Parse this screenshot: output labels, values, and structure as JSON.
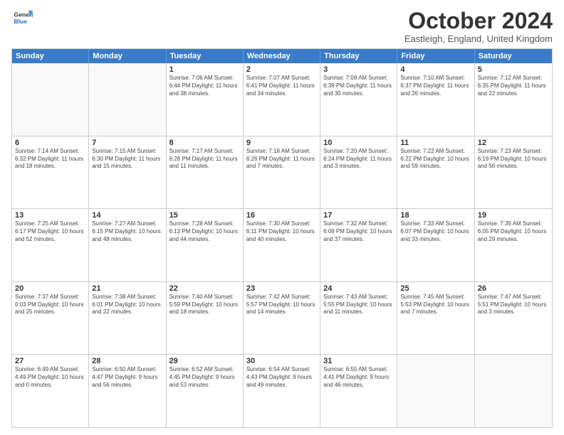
{
  "logo": {
    "general": "General",
    "blue": "Blue"
  },
  "header": {
    "month": "October 2024",
    "location": "Eastleigh, England, United Kingdom"
  },
  "weekdays": [
    "Sunday",
    "Monday",
    "Tuesday",
    "Wednesday",
    "Thursday",
    "Friday",
    "Saturday"
  ],
  "weeks": [
    [
      {
        "day": "",
        "info": ""
      },
      {
        "day": "",
        "info": ""
      },
      {
        "day": "1",
        "info": "Sunrise: 7:06 AM\nSunset: 6:44 PM\nDaylight: 11 hours and 38 minutes."
      },
      {
        "day": "2",
        "info": "Sunrise: 7:07 AM\nSunset: 6:41 PM\nDaylight: 11 hours and 34 minutes."
      },
      {
        "day": "3",
        "info": "Sunrise: 7:09 AM\nSunset: 6:39 PM\nDaylight: 11 hours and 30 minutes."
      },
      {
        "day": "4",
        "info": "Sunrise: 7:10 AM\nSunset: 6:37 PM\nDaylight: 11 hours and 26 minutes."
      },
      {
        "day": "5",
        "info": "Sunrise: 7:12 AM\nSunset: 6:35 PM\nDaylight: 11 hours and 22 minutes."
      }
    ],
    [
      {
        "day": "6",
        "info": "Sunrise: 7:14 AM\nSunset: 6:32 PM\nDaylight: 11 hours and 18 minutes."
      },
      {
        "day": "7",
        "info": "Sunrise: 7:15 AM\nSunset: 6:30 PM\nDaylight: 11 hours and 15 minutes."
      },
      {
        "day": "8",
        "info": "Sunrise: 7:17 AM\nSunset: 6:28 PM\nDaylight: 11 hours and 11 minutes."
      },
      {
        "day": "9",
        "info": "Sunrise: 7:18 AM\nSunset: 6:26 PM\nDaylight: 11 hours and 7 minutes."
      },
      {
        "day": "10",
        "info": "Sunrise: 7:20 AM\nSunset: 6:24 PM\nDaylight: 11 hours and 3 minutes."
      },
      {
        "day": "11",
        "info": "Sunrise: 7:22 AM\nSunset: 6:22 PM\nDaylight: 10 hours and 59 minutes."
      },
      {
        "day": "12",
        "info": "Sunrise: 7:23 AM\nSunset: 6:19 PM\nDaylight: 10 hours and 56 minutes."
      }
    ],
    [
      {
        "day": "13",
        "info": "Sunrise: 7:25 AM\nSunset: 6:17 PM\nDaylight: 10 hours and 52 minutes."
      },
      {
        "day": "14",
        "info": "Sunrise: 7:27 AM\nSunset: 6:15 PM\nDaylight: 10 hours and 48 minutes."
      },
      {
        "day": "15",
        "info": "Sunrise: 7:28 AM\nSunset: 6:13 PM\nDaylight: 10 hours and 44 minutes."
      },
      {
        "day": "16",
        "info": "Sunrise: 7:30 AM\nSunset: 6:11 PM\nDaylight: 10 hours and 40 minutes."
      },
      {
        "day": "17",
        "info": "Sunrise: 7:32 AM\nSunset: 6:09 PM\nDaylight: 10 hours and 37 minutes."
      },
      {
        "day": "18",
        "info": "Sunrise: 7:33 AM\nSunset: 6:07 PM\nDaylight: 10 hours and 33 minutes."
      },
      {
        "day": "19",
        "info": "Sunrise: 7:35 AM\nSunset: 6:05 PM\nDaylight: 10 hours and 29 minutes."
      }
    ],
    [
      {
        "day": "20",
        "info": "Sunrise: 7:37 AM\nSunset: 6:03 PM\nDaylight: 10 hours and 25 minutes."
      },
      {
        "day": "21",
        "info": "Sunrise: 7:38 AM\nSunset: 6:01 PM\nDaylight: 10 hours and 22 minutes."
      },
      {
        "day": "22",
        "info": "Sunrise: 7:40 AM\nSunset: 5:59 PM\nDaylight: 10 hours and 18 minutes."
      },
      {
        "day": "23",
        "info": "Sunrise: 7:42 AM\nSunset: 5:57 PM\nDaylight: 10 hours and 14 minutes."
      },
      {
        "day": "24",
        "info": "Sunrise: 7:43 AM\nSunset: 5:55 PM\nDaylight: 10 hours and 11 minutes."
      },
      {
        "day": "25",
        "info": "Sunrise: 7:45 AM\nSunset: 5:53 PM\nDaylight: 10 hours and 7 minutes."
      },
      {
        "day": "26",
        "info": "Sunrise: 7:47 AM\nSunset: 5:51 PM\nDaylight: 10 hours and 3 minutes."
      }
    ],
    [
      {
        "day": "27",
        "info": "Sunrise: 6:49 AM\nSunset: 4:49 PM\nDaylight: 10 hours and 0 minutes."
      },
      {
        "day": "28",
        "info": "Sunrise: 6:50 AM\nSunset: 4:47 PM\nDaylight: 9 hours and 56 minutes."
      },
      {
        "day": "29",
        "info": "Sunrise: 6:52 AM\nSunset: 4:45 PM\nDaylight: 9 hours and 53 minutes."
      },
      {
        "day": "30",
        "info": "Sunrise: 6:54 AM\nSunset: 4:43 PM\nDaylight: 9 hours and 49 minutes."
      },
      {
        "day": "31",
        "info": "Sunrise: 6:55 AM\nSunset: 4:41 PM\nDaylight: 9 hours and 46 minutes."
      },
      {
        "day": "",
        "info": ""
      },
      {
        "day": "",
        "info": ""
      }
    ]
  ]
}
